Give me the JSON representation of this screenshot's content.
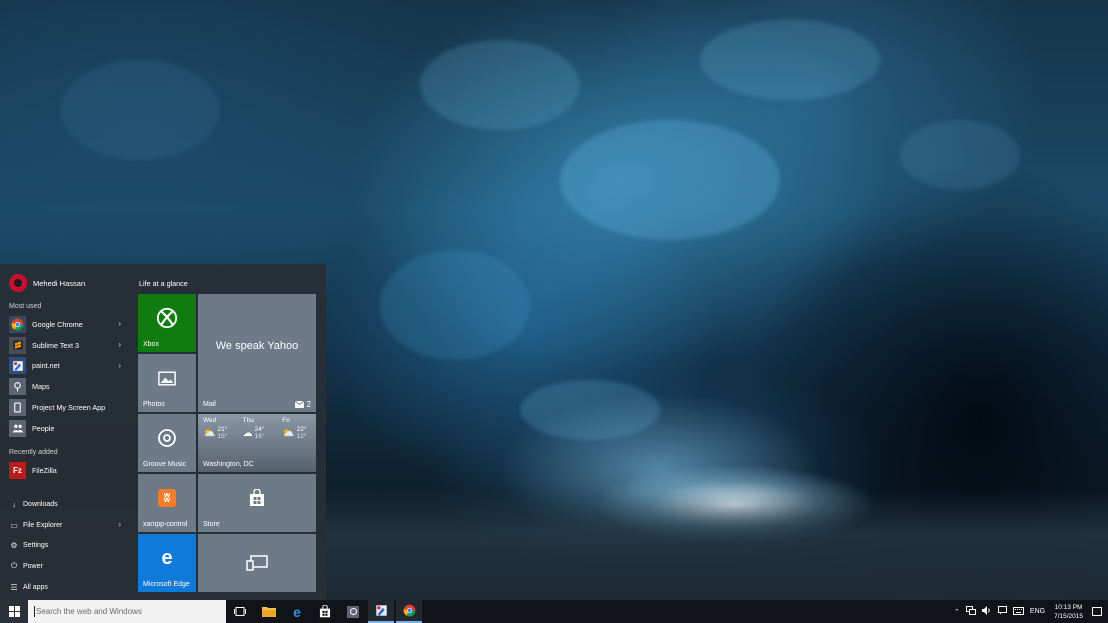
{
  "start_menu": {
    "user_name": "Mehedi Hassan",
    "most_used_label": "Most used",
    "most_used": [
      {
        "label": "Google Chrome",
        "icon": "chrome-icon",
        "has_arrow": true
      },
      {
        "label": "Sublime Text 3",
        "icon": "sublime-icon",
        "has_arrow": true
      },
      {
        "label": "paint.net",
        "icon": "paintnet-icon",
        "has_arrow": true
      },
      {
        "label": "Maps",
        "icon": "maps-icon",
        "has_arrow": false
      },
      {
        "label": "Project My Screen App",
        "icon": "project-screen-icon",
        "has_arrow": false
      },
      {
        "label": "People",
        "icon": "people-icon",
        "has_arrow": false
      }
    ],
    "recently_added_label": "Recently added",
    "recently_added": [
      {
        "label": "FileZilla",
        "icon": "filezilla-icon"
      }
    ],
    "system_items": [
      {
        "label": "Downloads",
        "icon": "download-icon",
        "glyph": "↓",
        "has_arrow": false
      },
      {
        "label": "File Explorer",
        "icon": "folder-icon",
        "glyph": "▭",
        "has_arrow": true
      },
      {
        "label": "Settings",
        "icon": "gear-icon",
        "glyph": "⚙",
        "has_arrow": false
      },
      {
        "label": "Power",
        "icon": "power-icon",
        "glyph": "⏻",
        "has_arrow": false
      },
      {
        "label": "All apps",
        "icon": "all-apps-icon",
        "glyph": "☰",
        "has_arrow": false
      }
    ],
    "arrow_glyph": "›",
    "tiles_group_label": "Life at a glance",
    "tiles": {
      "xbox": {
        "label": "Xbox",
        "color": "#107c10"
      },
      "mail": {
        "label": "Mail",
        "headline": "We speak Yahoo",
        "badge": "2"
      },
      "photos": {
        "label": "Photos"
      },
      "groove": {
        "label": "Groove Music"
      },
      "weather": {
        "location": "Washington, DC",
        "days": [
          {
            "day": "Wed",
            "high": "21°",
            "low": "15°"
          },
          {
            "day": "Thu",
            "high": "24°",
            "low": "16°"
          },
          {
            "day": "Fri",
            "high": "22°",
            "low": "12°"
          }
        ]
      },
      "xampp": {
        "label": "xampp-control",
        "color": "#e07b39"
      },
      "store": {
        "label": "Store"
      },
      "edge": {
        "label": "Microsoft Edge",
        "color": "#0f7ad8"
      },
      "devices": {
        "label": ""
      }
    }
  },
  "taskbar": {
    "search_placeholder": "Search the web and Windows",
    "tray": {
      "language": "ENG",
      "time": "10:13 PM",
      "date": "7/15/2015"
    }
  }
}
